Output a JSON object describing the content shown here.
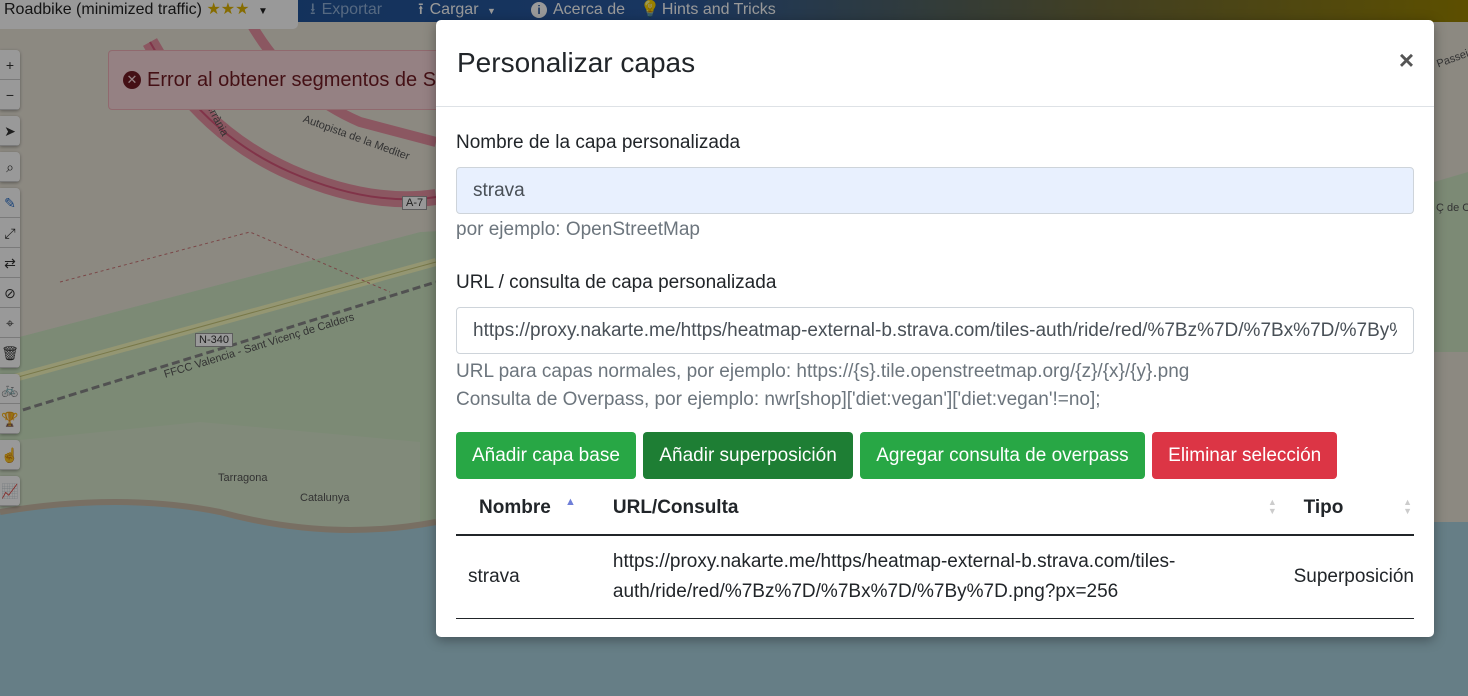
{
  "topbar": {
    "profile": "Roadbike (minimized traffic)",
    "stars": "★★★",
    "export": "Exportar",
    "load": "Cargar",
    "about": "Acerca de",
    "hints": "Hints and Tricks"
  },
  "map_labels": {
    "autopista": "Autopista de la Mediter",
    "a7": "A-7",
    "n340": "N-340",
    "ffcc": "FFCC Valencia - Sant Vicenç de Calders",
    "tarragona": "Tarragona",
    "catalunya": "Catalunya",
    "terrania": "Terrània",
    "passeig": "Passeig",
    "sant_vicenc": "Ç de Ca"
  },
  "error_banner": {
    "text": "Error al obtener segmentos de S"
  },
  "modal": {
    "title": "Personalizar capas",
    "close": "×",
    "name_label": "Nombre de la capa personalizada",
    "name_value": "strava",
    "name_help": "por ejemplo: OpenStreetMap",
    "url_label": "URL / consulta de capa personalizada",
    "url_value": "https://proxy.nakarte.me/https/heatmap-external-b.strava.com/tiles-auth/ride/red/%7Bz%7D/%7Bx%7D/%7By%7D.png?px=256",
    "url_help_1": "URL para capas normales, por ejemplo: https://{s}.tile.openstreetmap.org/{z}/{x}/{y}.png",
    "url_help_2": "Consulta de Overpass, por ejemplo: nwr[shop]['diet:vegan']['diet:vegan'!=no];",
    "buttons": {
      "add_base": "Añadir capa base",
      "add_overlay": "Añadir superposición",
      "add_overpass": "Agregar consulta de overpass",
      "delete": "Eliminar selección"
    },
    "table": {
      "headers": {
        "name": "Nombre",
        "url": "URL/Consulta",
        "type": "Tipo"
      },
      "rows": [
        {
          "name": "strava",
          "url_line1": "https://proxy.nakarte.me/https/heatmap-external-b.strava.com/tiles-",
          "url_line2": "auth/ride/red/%7Bz%7D/%7Bx%7D/%7By%7D.png?px=256",
          "type": "Superposición"
        }
      ]
    }
  }
}
